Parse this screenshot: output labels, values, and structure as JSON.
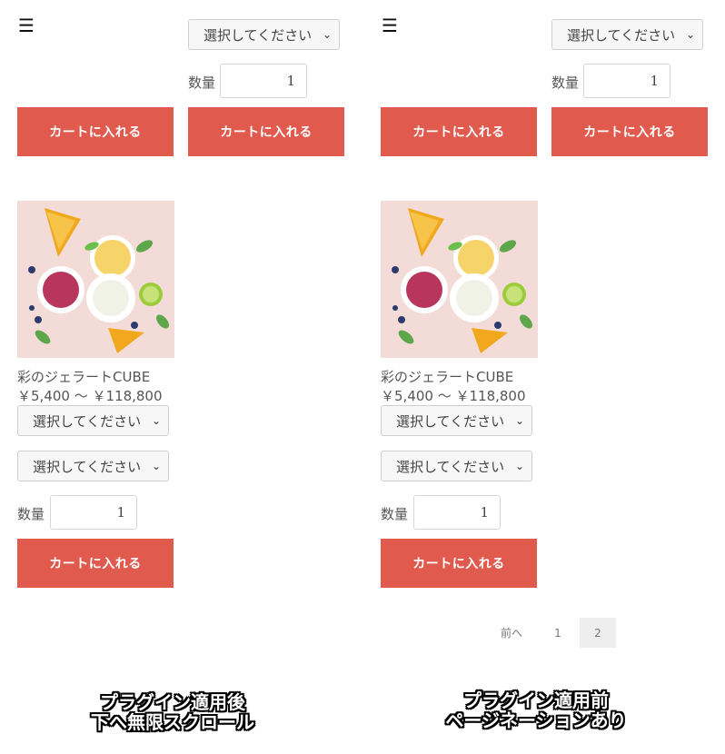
{
  "left": {
    "menu_icon": "hamburger-icon",
    "select_placeholder": "選択してください",
    "quantity_label": "数量",
    "quantity_value": "1",
    "cart_label": "カートに入れる",
    "product": {
      "name": "彩のジェラートCUBE",
      "price": "￥5,400 ～ ￥118,800"
    },
    "caption_line1": "プラグイン適用後",
    "caption_line2": "下へ無限スクロール"
  },
  "right": {
    "menu_icon": "hamburger-icon",
    "select_placeholder": "選択してください",
    "quantity_label": "数量",
    "quantity_value": "1",
    "cart_label": "カートに入れる",
    "product": {
      "name": "彩のジェラートCUBE",
      "price": "￥5,400 ～ ￥118,800"
    },
    "pagination": {
      "prev": "前へ",
      "pages": [
        "1",
        "2"
      ],
      "current": "2"
    },
    "caption_line1": "プラグイン適用前",
    "caption_line2": "ページネーションあり"
  },
  "colors": {
    "button": "#e05a4e",
    "select_bg": "#f7f7f7",
    "pager_current_bg": "#eeeeee"
  }
}
